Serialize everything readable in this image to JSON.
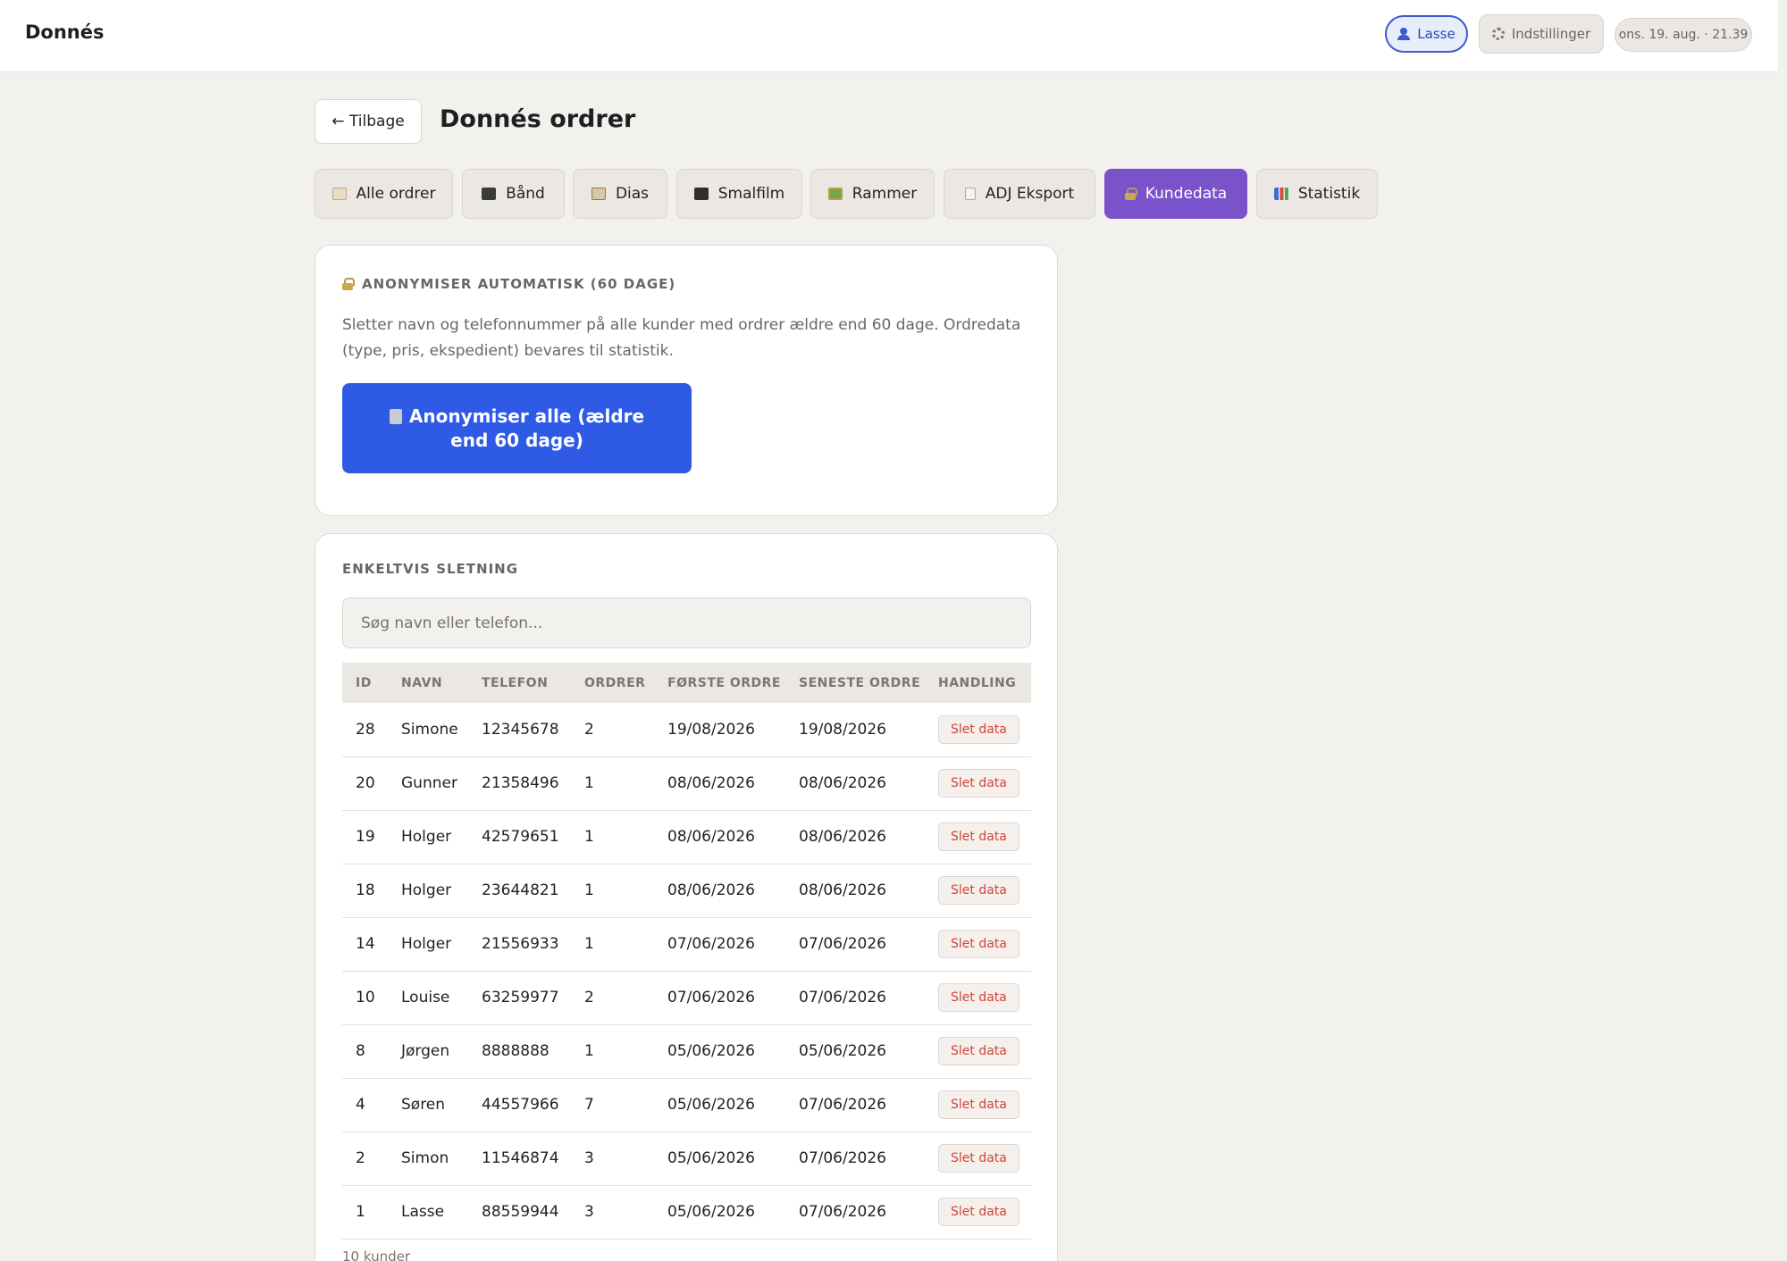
{
  "header": {
    "brand": "Donnés",
    "user": "Lasse",
    "settings": "Indstillinger",
    "clock": "ons. 19. aug. · 21.39"
  },
  "page": {
    "back": "← Tilbage",
    "title": "Donnés ordrer"
  },
  "tabs": [
    {
      "label": "Alle ordrer",
      "icon": "clipboard-icon",
      "active": false
    },
    {
      "label": "Bånd",
      "icon": "cassette-icon",
      "active": false
    },
    {
      "label": "Dias",
      "icon": "slides-icon",
      "active": false
    },
    {
      "label": "Smalfilm",
      "icon": "clapperboard-icon",
      "active": false
    },
    {
      "label": "Rammer",
      "icon": "frame-icon",
      "active": false
    },
    {
      "label": "ADJ Eksport",
      "icon": "document-icon",
      "active": false
    },
    {
      "label": "Kundedata",
      "icon": "lock-icon",
      "active": true
    },
    {
      "label": "Statistik",
      "icon": "bar-chart-icon",
      "active": false
    }
  ],
  "auto": {
    "heading": "ANONYMISER AUTOMATISK (60 DAGE)",
    "description": "Sletter navn og telefonnummer på alle kunder med ordrer ældre end 60 dage. Ordredata (type, pris, ekspedient) bevares til statistik.",
    "button": "Anonymiser alle (ældre end 60 dage)"
  },
  "manual": {
    "heading": "ENKELTVIS SLETNING",
    "search_placeholder": "Søg navn eller telefon...",
    "columns": [
      "ID",
      "NAVN",
      "TELEFON",
      "ORDRER",
      "FØRSTE ORDRE",
      "SENESTE ORDRE",
      "HANDLING"
    ],
    "rows": [
      {
        "id": "28",
        "name": "Simone",
        "phone": "12345678",
        "orders": "2",
        "first": "19/08/2026",
        "last": "19/08/2026",
        "action": "Slet data"
      },
      {
        "id": "20",
        "name": "Gunner",
        "phone": "21358496",
        "orders": "1",
        "first": "08/06/2026",
        "last": "08/06/2026",
        "action": "Slet data"
      },
      {
        "id": "19",
        "name": "Holger",
        "phone": "42579651",
        "orders": "1",
        "first": "08/06/2026",
        "last": "08/06/2026",
        "action": "Slet data"
      },
      {
        "id": "18",
        "name": "Holger",
        "phone": "23644821",
        "orders": "1",
        "first": "08/06/2026",
        "last": "08/06/2026",
        "action": "Slet data"
      },
      {
        "id": "14",
        "name": "Holger",
        "phone": "21556933",
        "orders": "1",
        "first": "07/06/2026",
        "last": "07/06/2026",
        "action": "Slet data"
      },
      {
        "id": "10",
        "name": "Louise",
        "phone": "63259977",
        "orders": "2",
        "first": "07/06/2026",
        "last": "07/06/2026",
        "action": "Slet data"
      },
      {
        "id": "8",
        "name": "Jørgen",
        "phone": "8888888",
        "orders": "1",
        "first": "05/06/2026",
        "last": "05/06/2026",
        "action": "Slet data"
      },
      {
        "id": "4",
        "name": "Søren",
        "phone": "44557966",
        "orders": "7",
        "first": "05/06/2026",
        "last": "07/06/2026",
        "action": "Slet data"
      },
      {
        "id": "2",
        "name": "Simon",
        "phone": "11546874",
        "orders": "3",
        "first": "05/06/2026",
        "last": "07/06/2026",
        "action": "Slet data"
      },
      {
        "id": "1",
        "name": "Lasse",
        "phone": "88559944",
        "orders": "3",
        "first": "05/06/2026",
        "last": "07/06/2026",
        "action": "Slet data"
      }
    ],
    "count": "10 kunder"
  },
  "colors": {
    "accent_tab": "#7a52c9",
    "primary_button": "#2e5ae6",
    "danger_text": "#d0443a"
  }
}
